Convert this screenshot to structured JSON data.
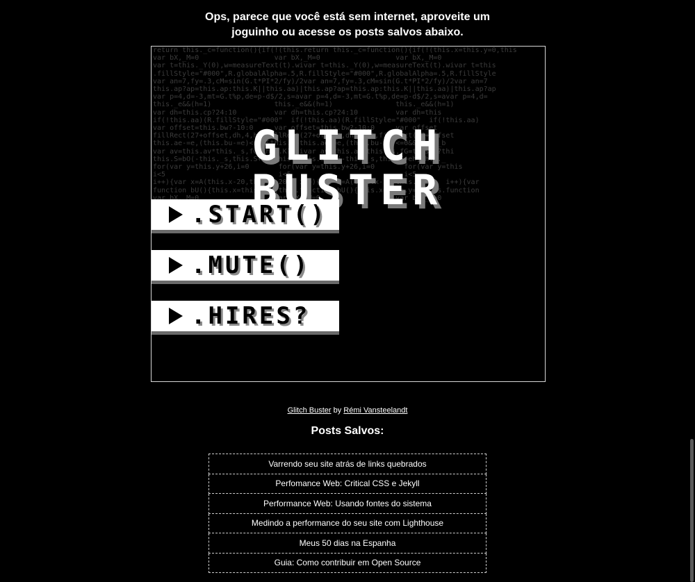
{
  "intro": {
    "line1": "Ops, parece que você está sem internet, aproveite um",
    "line2": "joguinho ou acesse os posts salvos abaixo."
  },
  "game": {
    "logo_line1": "GLITCH",
    "logo_line2": "BUSTER",
    "menu": [
      {
        "label": ".START()"
      },
      {
        "label": ".MUTE()"
      },
      {
        "label": ".HIRES?"
      }
    ],
    "background_code": "return this._c=function(){if(!(this.return this._c=function(){if(!(this.x=this.y=0,this\nvar bX,_M=0                  var bX,_M=0                  var bX,_M=0\nvar t=this._Y(0),w=measureText(t).wivar t=this._Y(0),w=measureText(t).wivar t=this\n.fillStyle=\"#000\",R.globalAlpha=.5,R.fillStyle=\"#000\",R.globalAlpha=.5,R.fillStyle\nvar an=7,fy=.3,cM=sin(G.t*PI*2/fy)/2var an=7,fy=.3,cM=sin(G.t*PI*2/fy)/2var an=7\nthis.ap?ap=this.ap:this.K||this.aa)|this.ap?ap=this.ap:this.K||this.aa)|this.ap?ap\nvar p=4,d=-3,mt=G.t%p,de=p-d$/2,s=avar p=4,d=-3,mt=G.t%p,de=p-d$/2,s=avar p=4,d=\nthis._e&&(h=1)               this._e&&(h=1)               this._e&&(h=1)\nvar dh=this.cp?24:10         var dh=this.cp?24:10         var dh=this\nif(!this.aa)(R.fillStyle=\"#000\"  if(!this.aa)(R.fillStyle=\"#000\"  if(!this.aa)\nvar offset=this.bw?-10:0     var offset=this.bw?-10:0     var offset\nfillRect(27+offset,dh,4,h),fillRect(27+offset,dh,4,h),fillRect(27+offset\nthis.ae-=e,(this.bu-=e)<=0&&this._bthis.ae-=e,(this.bu-=e)<=0&&this._b\nvar av=this.av*this._s,fG=this.K?thivar av=this.av*this._s,fG=this.K?thi\nthis.S=bO(-this._s,this.S+eh,this._this.S=bO(-this._s,this.S+eh,this._\nfor(var y=this.y+26,i=0       for(var y=this.y+26,i=0       for(var y=this\ni<5                           i<5                           i<5\ni++){var x=A(this.x-20,this.x+20)  i++){var x=A(this.x-20,this.x+20)  i++){var\nfunction bU(){this.x=this.y=u,this.function bU(){this.x=this.y=u,this.function\nvar bX,_M=0                  var bX,_M=0                  var bX,_M=0"
  },
  "credit": {
    "game_name": "Glitch Buster",
    "by": "by",
    "author": "Rémi Vansteelandt"
  },
  "saved": {
    "title": "Posts Salvos:",
    "posts": [
      "Varrendo seu site atrás de links quebrados",
      "Perfomance Web: Critical CSS e Jekyll",
      "Performance Web: Usando fontes do sistema",
      "Medindo a performance do seu site com Lighthouse",
      "Meus 50 dias na Espanha",
      "Guia: Como contribuir em Open Source"
    ]
  }
}
